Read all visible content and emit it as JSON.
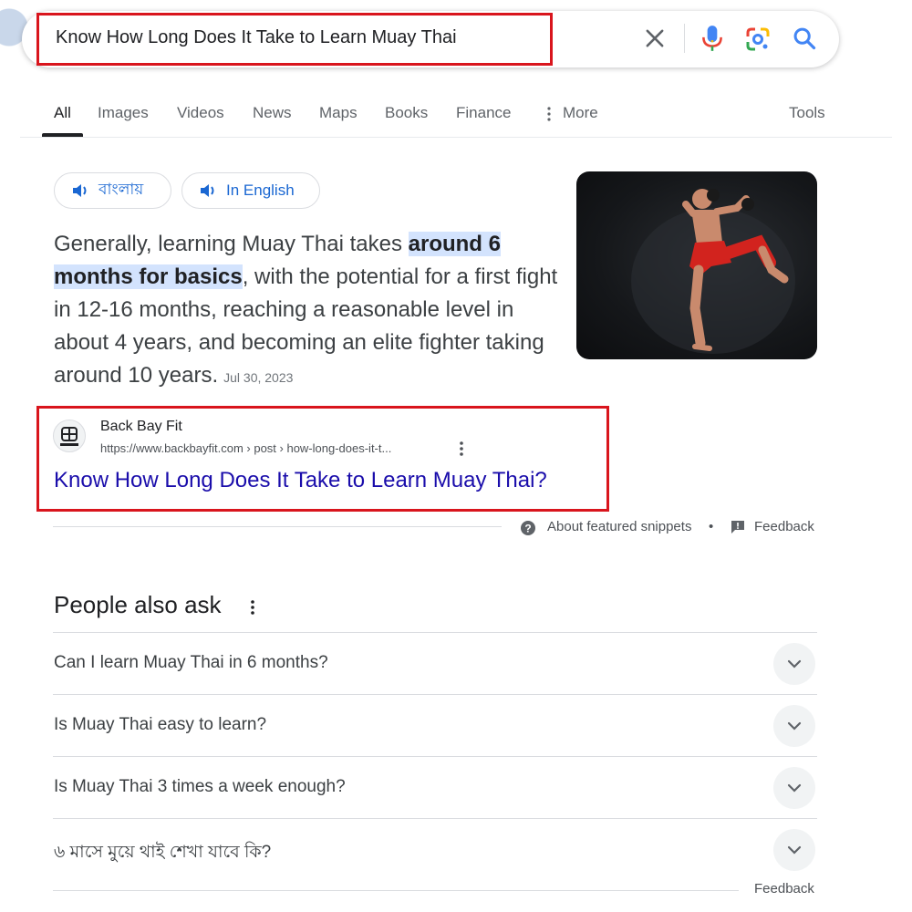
{
  "search": {
    "query": "Know How Long Does It Take to Learn Muay Thai"
  },
  "tabs": [
    {
      "label": "All"
    },
    {
      "label": "Images"
    },
    {
      "label": "Videos"
    },
    {
      "label": "News"
    },
    {
      "label": "Maps"
    },
    {
      "label": "Books"
    },
    {
      "label": "Finance"
    },
    {
      "label": "More"
    },
    {
      "label": "Tools"
    }
  ],
  "language_chips": [
    {
      "label": "বাংলায়"
    },
    {
      "label": "In English"
    }
  ],
  "snippet": {
    "before": "Generally, learning Muay Thai takes ",
    "highlight": "around 6 months for basics",
    "after": ", with the potential for a first fight in 12-16 months, reaching a reasonable level in about 4 years, and becoming an elite fighter taking around 10 years.",
    "date": "Jul 30, 2023"
  },
  "source": {
    "site_name": "Back Bay Fit",
    "url": "https://www.backbayfit.com › post › how-long-does-it-t...",
    "title": "Know How Long Does It Take to Learn Muay Thai?"
  },
  "snippet_footer": {
    "about": "About featured snippets",
    "separator": "•",
    "feedback": "Feedback"
  },
  "people_also_ask": {
    "title": "People also ask",
    "questions": [
      "Can I learn Muay Thai in 6 months?",
      "Is Muay Thai easy to learn?",
      "Is Muay Thai 3 times a week enough?",
      "৬ মাসে মুয়ে থাই শেখা যাবে কি?"
    ],
    "feedback": "Feedback"
  },
  "icons": {
    "clear": "close-icon",
    "mic": "microphone-icon",
    "lens": "google-lens-icon",
    "search": "search-icon",
    "more": "vertical-dots-icon",
    "speaker": "speaker-icon",
    "help": "help-circle-icon",
    "feedback": "feedback-flag-icon",
    "expand": "chevron-down-icon"
  },
  "colors": {
    "link": "#1a0dab",
    "chip_text": "#1a67d2",
    "highlight": "#d3e3fd",
    "annotation_box": "#d9151d"
  }
}
